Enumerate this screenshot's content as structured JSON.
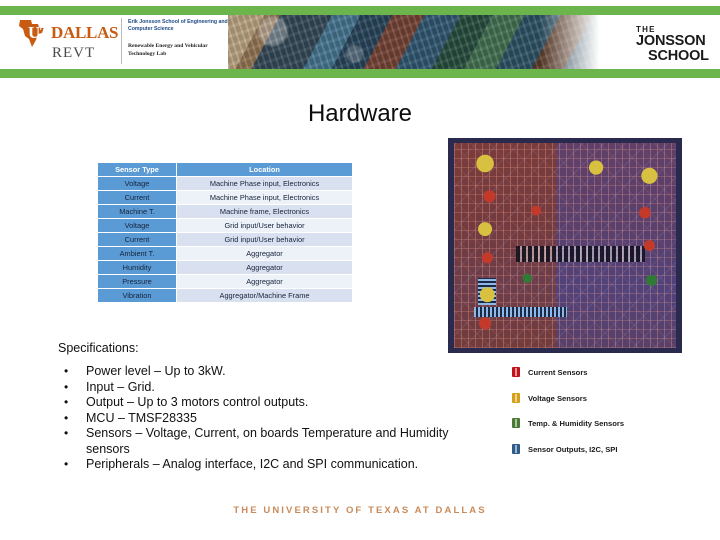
{
  "header": {
    "logo": {
      "icon": "texas-outline-icon",
      "ut": "UT",
      "dallas": "DALLAS",
      "revt": "REVT",
      "school": "Erik Jonsson School of Engineering and Computer Science",
      "lab": "Renewable Energy and Vehicular Technology Lab"
    },
    "jonsson_mark": {
      "the": "THE",
      "jonsson": "JONSSON",
      "school": "SCHOOL"
    },
    "accent_green": "#6CB44C"
  },
  "slide": {
    "title": "Hardware"
  },
  "table": {
    "columns": [
      "Sensor Type",
      "Location"
    ],
    "header_bg": "#5B9BD5",
    "rows": [
      {
        "type": "Voltage",
        "location": "Machine Phase input, Electronics"
      },
      {
        "type": "Current",
        "location": "Machine Phase input, Electronics"
      },
      {
        "type": "Machine T.",
        "location": "Machine frame, Electronics"
      },
      {
        "type": "Voltage",
        "location": "Grid input/User behavior"
      },
      {
        "type": "Current",
        "location": "Grid input/User behavior"
      },
      {
        "type": "Ambient T.",
        "location": "Aggregator"
      },
      {
        "type": "Humidity",
        "location": "Aggregator"
      },
      {
        "type": "Pressure",
        "location": "Aggregator"
      },
      {
        "type": "Vibration",
        "location": "Aggregator/Machine Frame"
      }
    ]
  },
  "pcb": {
    "name": "pcb-layout-image"
  },
  "specifications": {
    "heading": "Specifications:",
    "bullet": "•",
    "items": [
      "Power level – Up to 3kW.",
      "Input – Grid.",
      "Output – Up to 3 motors control outputs.",
      "MCU – TMSF28335",
      "Sensors – Voltage, Current, on boards Temperature and Humidity sensors",
      "Peripherals – Analog interface, I2C and SPI communication."
    ]
  },
  "legend": {
    "items": [
      {
        "label": "Current Sensors",
        "color": "#C0121B"
      },
      {
        "label": "Voltage Sensors",
        "color": "#D4A017"
      },
      {
        "label": "Temp. & Humidity Sensors",
        "color": "#4B7A35"
      },
      {
        "label": "Sensor Outputs, I2C, SPI",
        "color": "#2E5C8A"
      }
    ]
  },
  "footer": {
    "text": "THE UNIVERSITY OF TEXAS AT DALLAS",
    "color": "#C98B5A"
  }
}
